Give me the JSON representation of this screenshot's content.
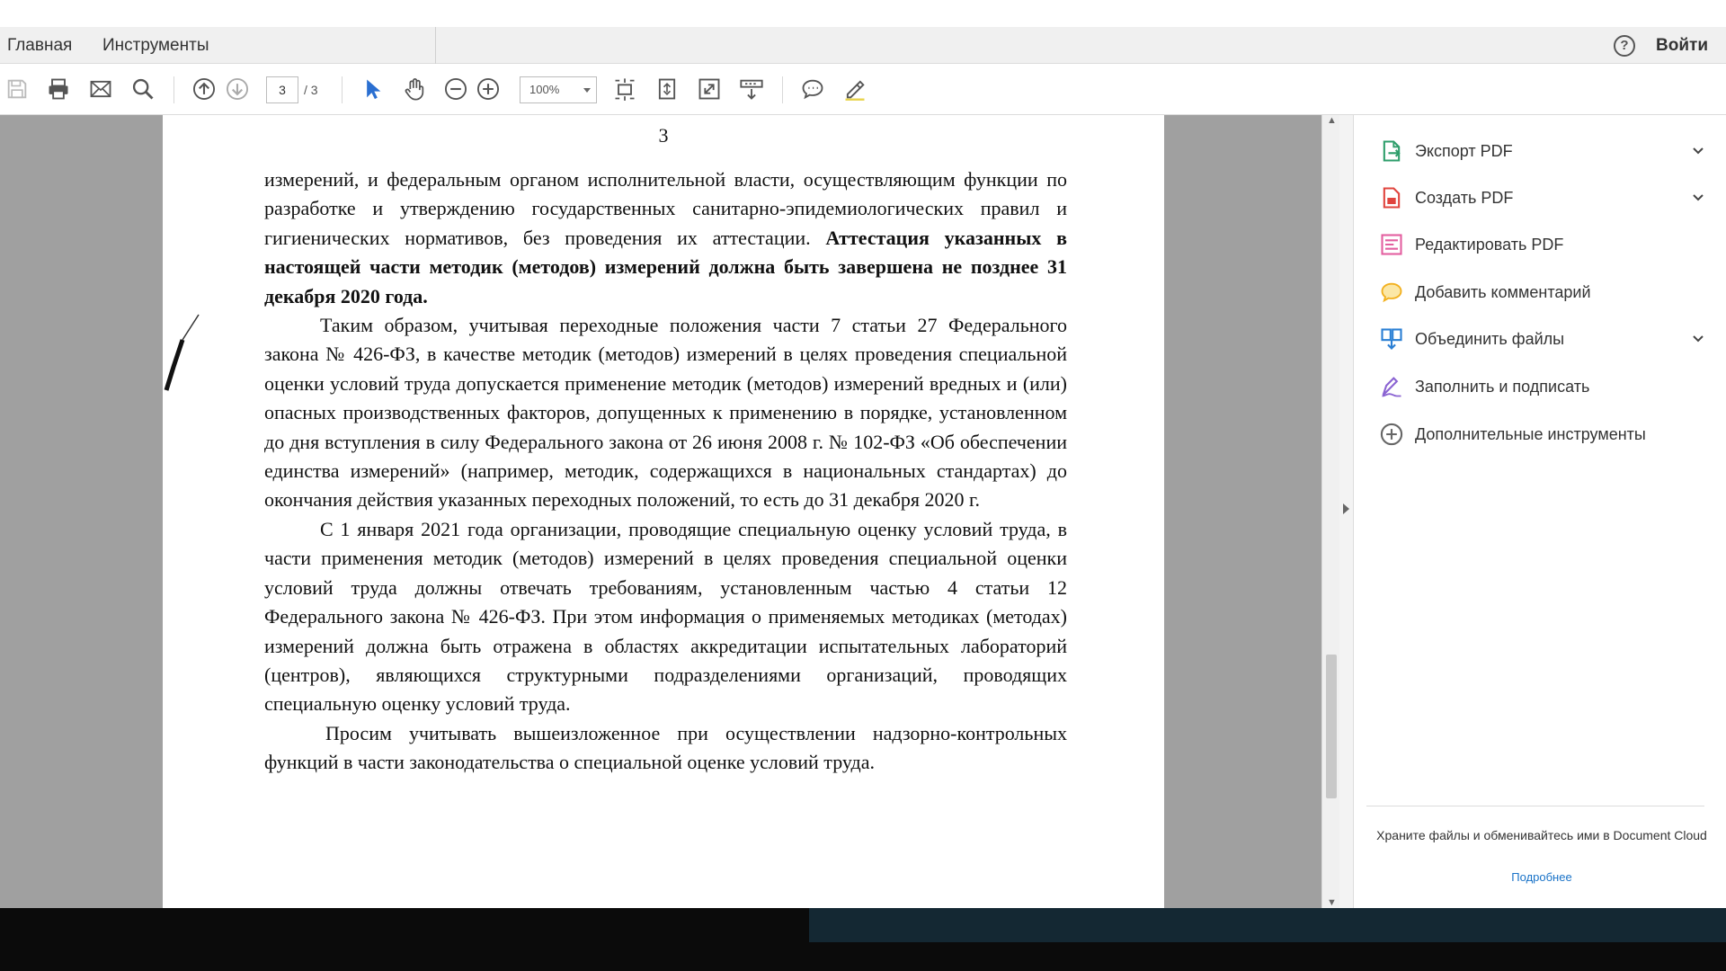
{
  "menu": {
    "home": "Главная",
    "tools": "Инструменты",
    "help": "?",
    "signin": "Войти"
  },
  "toolbar": {
    "page_current": "3",
    "page_total": "/ 3",
    "zoom": "100%"
  },
  "document": {
    "page_number": "3",
    "p1_text": "измерений, и федеральным органом исполнительной власти, осуществляющим функции по разработке и утверждению государственных санитарно-эпидемиологических правил и гигиенических нормативов, без проведения их аттестации.",
    "p1_bold": "Аттестация указанных в настоящей части методик (методов) измерений должна быть завершена не позднее 31 декабря 2020 года.",
    "p2": "Таким образом, учитывая переходные положения части 7 статьи 27 Федерального закона № 426-ФЗ, в качестве методик (методов) измерений в целях проведения специальной оценки условий труда допускается применение методик (методов) измерений вредных и (или) опасных производственных факторов, допущенных к применению в порядке, установленном до дня вступления в силу Федерального закона от 26 июня 2008 г. № 102-ФЗ «Об обеспечении единства измерений» (например, методик, содержащихся в национальных стандартах) до окончания действия указанных переходных положений, то есть до 31 декабря 2020 г.",
    "p3": "С 1 января 2021 года организации, проводящие специальную оценку условий труда, в части применения методик (методов) измерений в целях проведения специальной оценки условий труда должны отвечать требованиям, установленным частью 4 статьи 12 Федерального закона № 426-ФЗ. При этом информация о применяемых методиках (методах) измерений должна быть отражена в областях аккредитации испытательных лабораторий (центров), являющихся структурными подразделениями организаций, проводящих специальную оценку условий труда.",
    "p4": "Просим учитывать вышеизложенное при осуществлении надзорно-контрольных функций в части законодательства о специальной оценке условий труда."
  },
  "panel": {
    "tools": [
      {
        "label": "Экспорт PDF",
        "icon": "export-pdf-icon",
        "color": "#2e9e6b",
        "expandable": true
      },
      {
        "label": "Создать PDF",
        "icon": "create-pdf-icon",
        "color": "#e0443e",
        "expandable": true
      },
      {
        "label": "Редактировать PDF",
        "icon": "edit-pdf-icon",
        "color": "#e35fa0",
        "expandable": false
      },
      {
        "label": "Добавить комментарий",
        "icon": "comment-icon",
        "color": "#f2b01e",
        "expandable": false
      },
      {
        "label": "Объединить файлы",
        "icon": "combine-files-icon",
        "color": "#2a7fd4",
        "expandable": true
      },
      {
        "label": "Заполнить и подписать",
        "icon": "fill-sign-icon",
        "color": "#8a63d2",
        "expandable": false
      },
      {
        "label": "Дополнительные инструменты",
        "icon": "more-tools-icon",
        "color": "#666666",
        "expandable": false
      }
    ],
    "cloud_text": "Храните файлы и обменивайтесь ими в Document Cloud",
    "cloud_link": "Подробнее"
  }
}
